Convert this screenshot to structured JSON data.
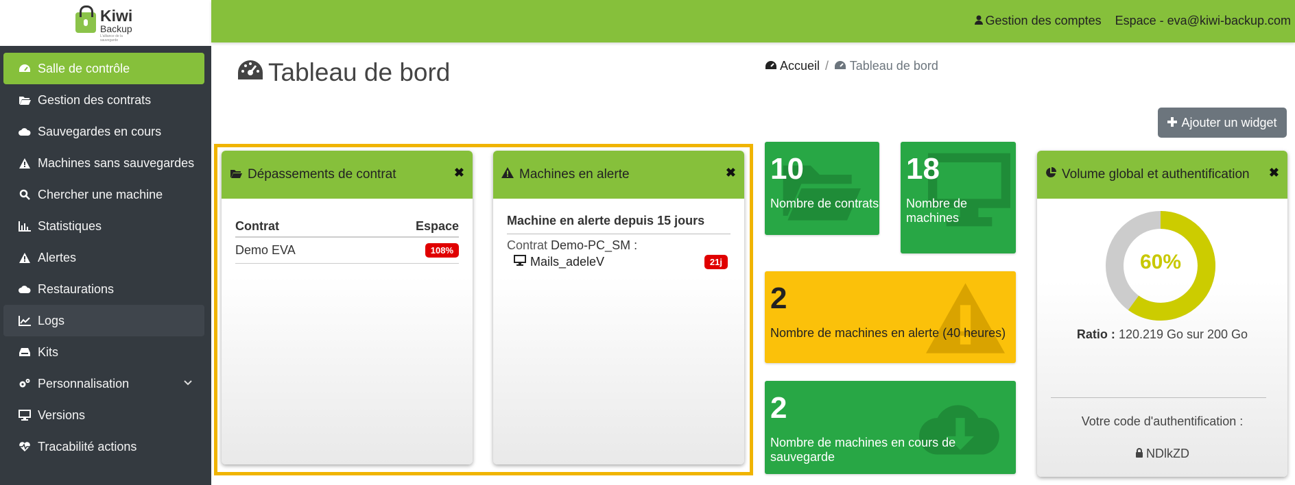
{
  "brand": {
    "name": "Kiwi",
    "sub": "Backup",
    "tagline": "L'alliance de la sauvegarde"
  },
  "sidebar": {
    "items": [
      {
        "label": "Salle de contrôle",
        "icon": "gauge-icon"
      },
      {
        "label": "Gestion des contrats",
        "icon": "folder-open-icon"
      },
      {
        "label": "Sauvegardes en cours",
        "icon": "cloud-upload-icon"
      },
      {
        "label": "Machines sans sauvegardes",
        "icon": "warning-icon"
      },
      {
        "label": "Chercher une machine",
        "icon": "search-icon"
      },
      {
        "label": "Statistiques",
        "icon": "bar-chart-icon"
      },
      {
        "label": "Alertes",
        "icon": "warning-icon"
      },
      {
        "label": "Restaurations",
        "icon": "cloud-download-icon"
      },
      {
        "label": "Logs",
        "icon": "line-chart-icon"
      },
      {
        "label": "Kits",
        "icon": "inbox-icon"
      },
      {
        "label": "Personnalisation",
        "icon": "cogs-icon"
      },
      {
        "label": "Versions",
        "icon": "desktop-icon"
      },
      {
        "label": "Tracabilité actions",
        "icon": "heartbeat-icon"
      }
    ]
  },
  "topbar": {
    "accounts": "Gestion des comptes",
    "space": "Espace - eva@kiwi-backup.com"
  },
  "page": {
    "title": "Tableau de bord",
    "breadcrumb_home": "Accueil",
    "breadcrumb_sep": "/",
    "breadcrumb_current": "Tableau de bord",
    "add_widget": "Ajouter un widget"
  },
  "widget_overrun": {
    "title": "Dépassements de contrat",
    "col_contract": "Contrat",
    "col_space": "Espace",
    "rows": [
      {
        "contract": "Demo EVA",
        "space": "108%"
      }
    ]
  },
  "widget_alerts": {
    "title": "Machines en alerte",
    "subtitle": "Machine en alerte depuis 15 jours",
    "contract_label": "Contrat",
    "contract_value": "Demo-PC_SM :",
    "machine": "Mails_adeleV",
    "badge": "21j"
  },
  "stats": {
    "contracts": {
      "value": "10",
      "label": "Nombre de contrats"
    },
    "machines": {
      "value": "18",
      "label": "Nombre de machines"
    },
    "alerts": {
      "value": "2",
      "label": "Nombre de machines en alerte (40 heures)"
    },
    "backups": {
      "value": "2",
      "label": "Nombre de machines en cours de sauvegarde"
    }
  },
  "widget_volume": {
    "title": "Volume global et authentification",
    "percent_label": "60%",
    "percent": 60,
    "ratio_label": "Ratio :",
    "ratio_value": "120.219 Go sur 200 Go",
    "auth_label": "Votre code d'authentification :",
    "auth_code": "NDlkZD"
  },
  "colors": {
    "accent": "#86c03b",
    "sidebar": "#343a40",
    "success": "#28a745",
    "warning": "#fbc10a",
    "danger": "#e00000",
    "highlight": "#f0b400",
    "donut_fill": "#cccc00",
    "donut_rest": "#cccccc"
  }
}
